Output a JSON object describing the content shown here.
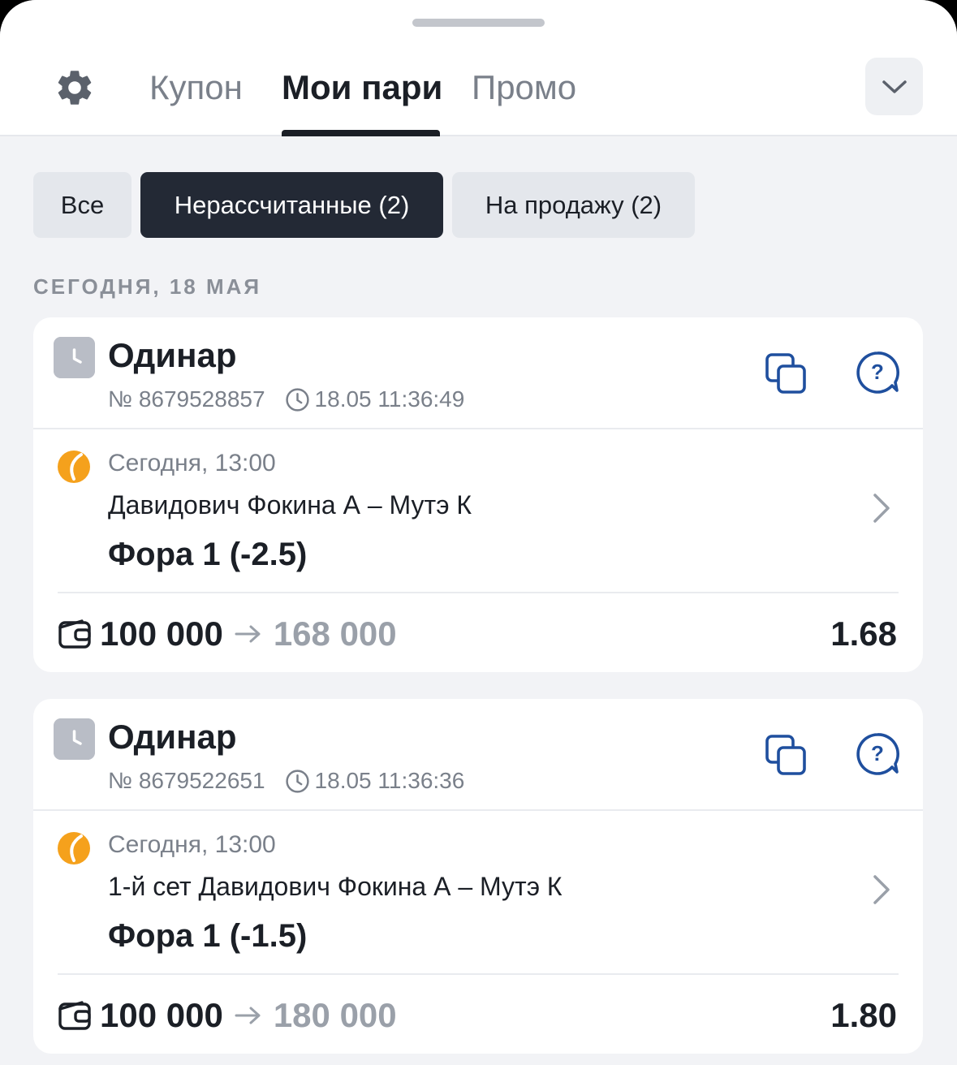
{
  "tabs": [
    {
      "label": "Купон",
      "active": false
    },
    {
      "label": "Мои пари",
      "active": true
    },
    {
      "label": "Промо",
      "active": false
    }
  ],
  "filters": [
    {
      "label": "Все",
      "active": false
    },
    {
      "label": "Нерассчитанные (2)",
      "active": true
    },
    {
      "label": "На продажу (2)",
      "active": false
    }
  ],
  "date_header": "СЕГОДНЯ, 18 МАЯ",
  "bets": [
    {
      "type": "Одинар",
      "number": "№ 8679528857",
      "placed_at": "18.05 11:36:49",
      "event_time": "Сегодня, 13:00",
      "event_name": "Давидович Фокина А – Мутэ К",
      "market": "Фора 1 (-2.5)",
      "stake": "100 000",
      "payout": "168 000",
      "odds": "1.68"
    },
    {
      "type": "Одинар",
      "number": "№ 8679522651",
      "placed_at": "18.05 11:36:36",
      "event_time": "Сегодня, 13:00",
      "event_name": "1-й сет Давидович Фокина А – Мутэ К",
      "market": "Фора 1 (-1.5)",
      "stake": "100 000",
      "payout": "180 000",
      "odds": "1.80"
    }
  ],
  "icons": {
    "settings": "gear-icon",
    "collapse": "chevron-down-icon",
    "status": "clock-icon",
    "copy": "copy-icon",
    "help": "help-bubble-icon",
    "sport": "tennis-ball-icon",
    "event_link": "chevron-right-icon",
    "stake": "wallet-icon"
  },
  "colors": {
    "accent_blue": "#1f4f9e",
    "tennis_orange": "#f5a11c",
    "active_filter_bg": "#232935",
    "page_bg": "#f2f3f6"
  }
}
